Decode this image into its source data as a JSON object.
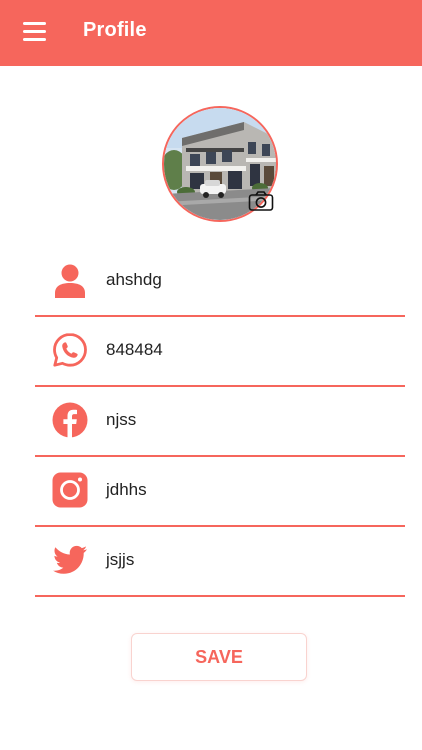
{
  "colors": {
    "accent": "#f6665c",
    "text": "#222222",
    "background": "#ffffff"
  },
  "header": {
    "title": "Profile",
    "menu_icon": "hamburger-menu-icon"
  },
  "avatar": {
    "photo": "building-street-photo",
    "camera_icon": "camera-icon"
  },
  "fields": [
    {
      "icon": "user-icon",
      "value": "ahshdg"
    },
    {
      "icon": "whatsapp-icon",
      "value": "848484"
    },
    {
      "icon": "facebook-icon",
      "value": "njss"
    },
    {
      "icon": "instagram-icon",
      "value": "jdhhs"
    },
    {
      "icon": "twitter-icon",
      "value": "jsjjs"
    }
  ],
  "save_button": {
    "label": "SAVE"
  }
}
